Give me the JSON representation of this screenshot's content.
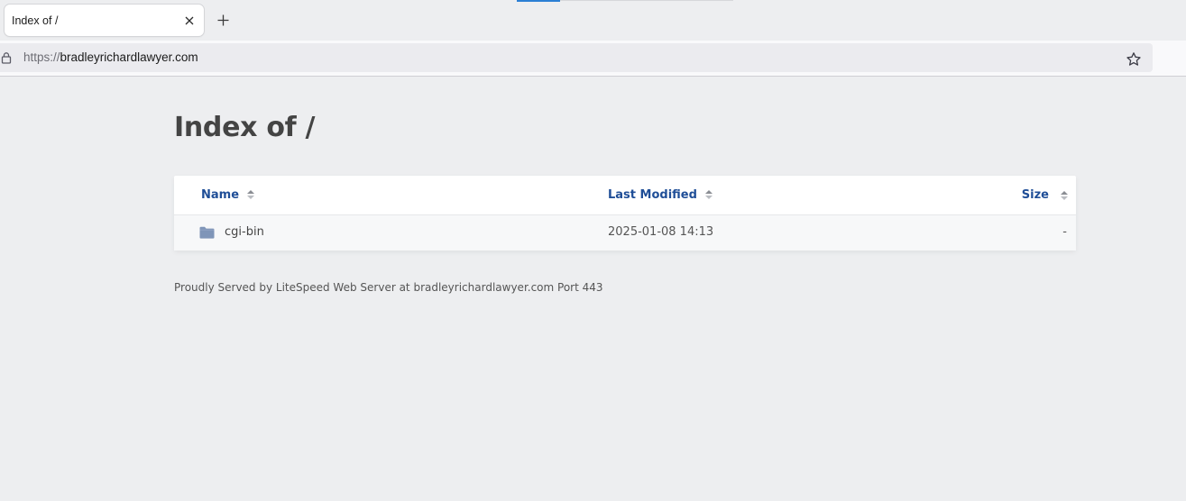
{
  "browser": {
    "tab_title": "Index of /",
    "url_scheme": "https://",
    "url_host": "bradleyrichardlawyer.com"
  },
  "page": {
    "title": "Index of /",
    "columns": {
      "name": "Name",
      "modified": "Last Modified",
      "size": "Size"
    },
    "rows": [
      {
        "name": "cgi-bin",
        "modified": "2025-01-08 14:13",
        "size": "-",
        "icon": "folder-icon"
      }
    ],
    "footer": "Proudly Served by LiteSpeed Web Server at bradleyrichardlawyer.com Port 443"
  },
  "colors": {
    "header_link": "#1f4e97",
    "folder_icon": "#7f95b8",
    "page_bg": "#edeef0"
  }
}
